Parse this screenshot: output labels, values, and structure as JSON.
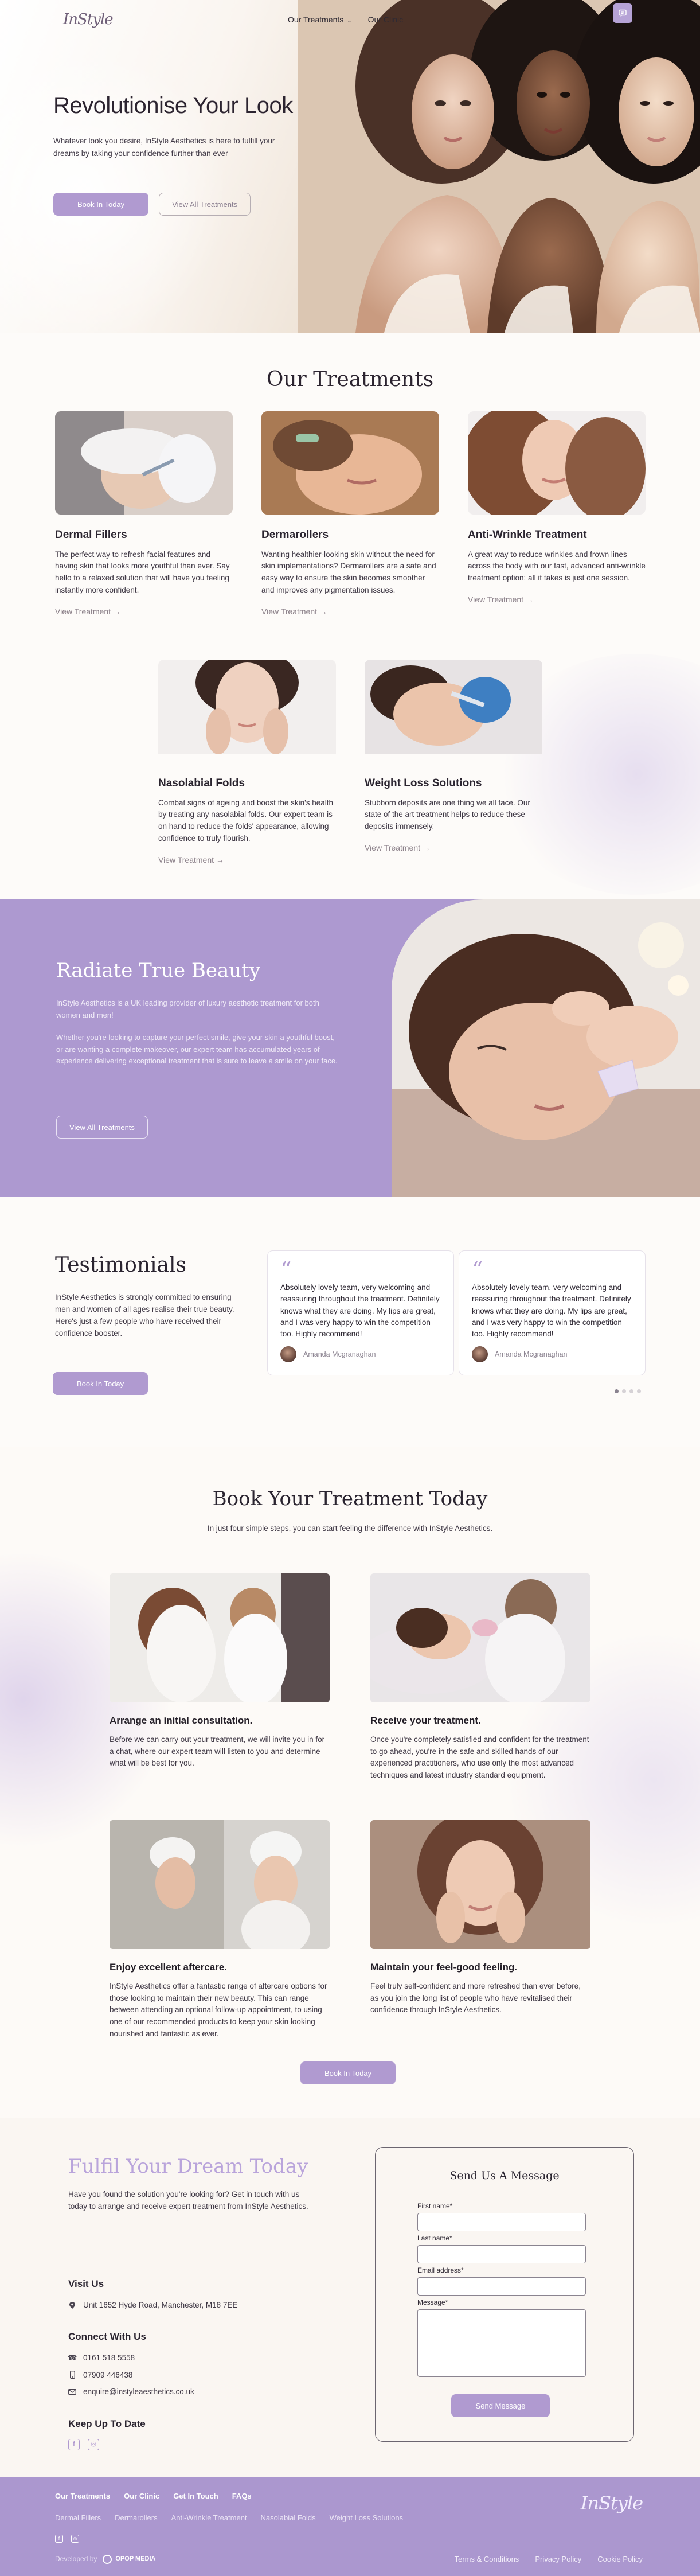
{
  "header": {
    "logo": "InStyle",
    "nav": [
      {
        "label": "Our Treatments",
        "dropdown": true
      },
      {
        "label": "Our Clinic",
        "dropdown": false
      }
    ]
  },
  "hero": {
    "title": "Revolutionise Your Look",
    "subtitle": "Whatever look you desire, InStyle Aesthetics is here to fulfill your dreams by taking your confidence further than ever",
    "primary_button": "Book In Today",
    "secondary_button": "View All Treatments"
  },
  "treatments": {
    "title": "Our Treatments",
    "link_label": "View Treatment",
    "items": [
      {
        "name": "Dermal Fillers",
        "description": "The perfect way to refresh facial features and having skin that looks more youthful than ever. Say hello to a relaxed solution that will have you feeling instantly more confident."
      },
      {
        "name": "Dermarollers",
        "description": "Wanting healthier-looking skin without the need for skin implementations? Dermarollers are a safe and easy way to ensure the skin becomes smoother and improves any pigmentation issues."
      },
      {
        "name": "Anti-Wrinkle Treatment",
        "description": "A great way to reduce wrinkles and frown lines across the body with our fast, advanced anti-wrinkle treatment option: all it takes is just one session."
      },
      {
        "name": "Nasolabial Folds",
        "description": "Combat signs of ageing and boost the skin's health by treating any nasolabial folds. Our expert team is on hand to reduce the folds' appearance, allowing confidence to truly flourish."
      },
      {
        "name": "Weight Loss Solutions",
        "description": "Stubborn deposits are one thing we all face. Our state of the art treatment helps to reduce these deposits immensely."
      }
    ]
  },
  "radiate": {
    "title": "Radiate True Beauty",
    "paragraph_1": "InStyle Aesthetics is a UK leading provider of luxury aesthetic treatment for both women and men!",
    "paragraph_2": "Whether you're looking to capture your perfect smile, give your skin a youthful boost, or are wanting a complete makeover, our expert team has accumulated years of experience delivering exceptional treatment that is sure to leave a smile on your face.",
    "button": "View All Treatments"
  },
  "testimonials": {
    "title": "Testimonials",
    "description": "InStyle Aesthetics is strongly committed to ensuring men and women of all ages realise their true beauty. Here's just a few people who have received their confidence booster.",
    "button": "Book In Today",
    "items": [
      {
        "quote": "Absolutely lovely team, very welcoming and reassuring throughout the treatment. Definitely knows what they are doing. My lips are great, and I was very happy to win the competition too. Highly recommend!",
        "author": "Amanda Mcgranaghan"
      },
      {
        "quote": "Absolutely lovely team, very welcoming and reassuring throughout the treatment. Definitely knows what they are doing. My lips are great, and I was very happy to win the competition too. Highly recommend!",
        "author": "Amanda Mcgranaghan"
      }
    ],
    "slider_pages": 4,
    "active_page": 1
  },
  "book": {
    "title": "Book Your Treatment Today",
    "lead": "In just four simple steps, you can start feeling the difference with InStyle Aesthetics.",
    "steps": [
      {
        "title": "Arrange an initial consultation.",
        "text": "Before we can carry out your treatment, we will invite you in for a chat, where our expert team will listen to you and determine what will be best for you."
      },
      {
        "title": "Receive your treatment.",
        "text": "Once you're completely satisfied and confident for the treatment to go ahead, you're in the safe and skilled hands of our experienced practitioners, who use only the most advanced techniques and latest industry standard equipment."
      },
      {
        "title": "Enjoy excellent aftercare.",
        "text": "InStyle Aesthetics offer a fantastic range of aftercare options for those looking to maintain their new beauty. This can range between attending an optional follow-up appointment, to using one of our recommended products to keep your skin looking nourished and fantastic as ever."
      },
      {
        "title": "Maintain your feel-good feeling.",
        "text": "Feel truly self-confident and more refreshed than ever before, as you join the long list of people who have revitalised their confidence through InStyle Aesthetics."
      }
    ],
    "button": "Book In Today"
  },
  "contact": {
    "title": "Fulfil Your Dream Today",
    "intro": "Have you found the solution you're looking for? Get in touch with us today to arrange and receive expert treatment from InStyle Aesthetics.",
    "visit_title": "Visit Us",
    "address": "Unit 1652 Hyde Road, Manchester, M18 7EE",
    "connect_title": "Connect With Us",
    "phone_1": "0161 518 5558",
    "phone_2": "07909 446438",
    "email": "enquire@instyleaesthetics.co.uk",
    "social_title": "Keep Up To Date",
    "form": {
      "title": "Send Us A Message",
      "first_name_label": "First name*",
      "last_name_label": "Last name*",
      "email_label": "Email address*",
      "message_label": "Message*",
      "submit": "Send Message"
    }
  },
  "footer": {
    "nav": [
      "Our Treatments",
      "Our Clinic",
      "Get In Touch",
      "FAQs"
    ],
    "treatments": [
      "Dermal Fillers",
      "Dermarollers",
      "Anti-Wrinkle Treatment",
      "Nasolabial Folds",
      "Weight Loss Solutions"
    ],
    "logo": "InStyle",
    "developed_by": "Developed by",
    "developer": "OPOP MEDIA",
    "legal": [
      "Terms & Conditions",
      "Privacy Policy",
      "Cookie Policy"
    ]
  },
  "colors": {
    "accent": "#b09ad0",
    "purple_section": "#ad99d0",
    "footer": "#ab97cf",
    "heading": "#2c2430"
  }
}
